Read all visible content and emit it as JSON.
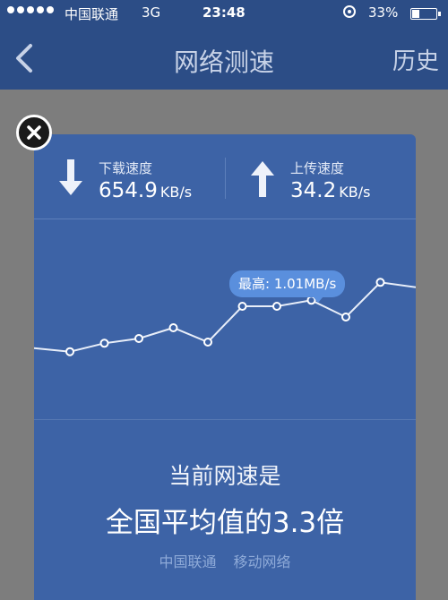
{
  "status_bar": {
    "carrier": "中国联通",
    "network": "3G",
    "time": "23:48",
    "battery_percent": "33%",
    "battery_level": 0.33
  },
  "nav": {
    "back_icon": "chevron-left-icon",
    "title": "网络测速",
    "history_label": "历史"
  },
  "result": {
    "download": {
      "label": "下载速度",
      "value": "654.9",
      "unit": "KB/s",
      "icon": "download-arrow-icon"
    },
    "upload": {
      "label": "上传速度",
      "value": "34.2",
      "unit": "KB/s",
      "icon": "upload-arrow-icon"
    }
  },
  "chart_data": {
    "type": "line",
    "peak_label": "最高: 1.01MB/s",
    "values": [
      0.46,
      0.43,
      0.5,
      0.54,
      0.63,
      0.51,
      0.81,
      0.81,
      0.86,
      0.72,
      1.01,
      0.97
    ],
    "ylim": [
      0,
      1.2
    ],
    "grid": false
  },
  "summary": {
    "line1": "当前网速是",
    "line2": "全国平均值的3.3倍",
    "carrier_tags": [
      "中国联通",
      "移动网络"
    ]
  },
  "colors": {
    "nav_background": "#2c4d86",
    "card_background": "#3d63a6",
    "tooltip_background": "#5a8fdd",
    "overlay": "#7d7d7d"
  }
}
